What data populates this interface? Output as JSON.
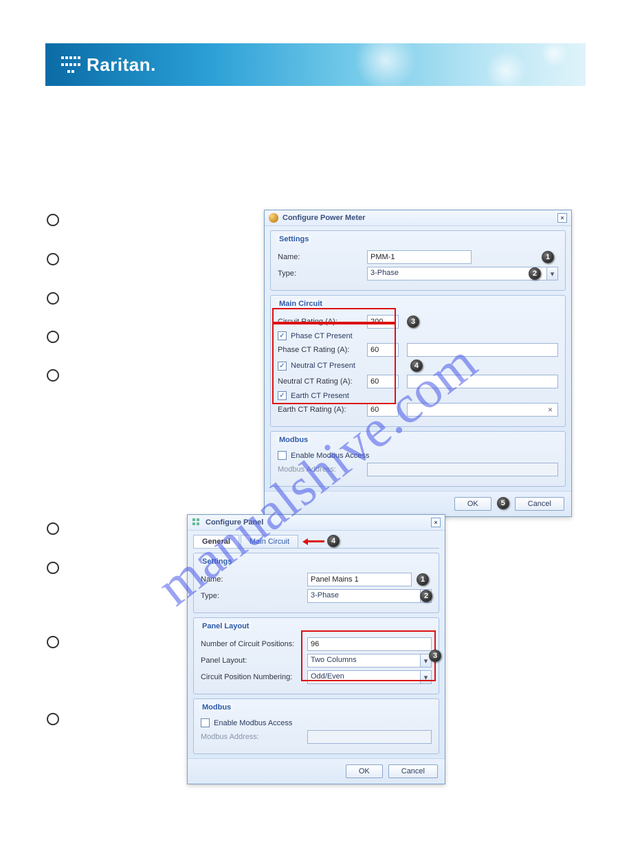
{
  "logo_text": "Raritan",
  "logo_dot": ".",
  "dialog1": {
    "title": "Configure Power Meter",
    "settings_title": "Settings",
    "name_label": "Name:",
    "name_value": "PMM-1",
    "type_label": "Type:",
    "type_value": "3-Phase",
    "main_circuit_title": "Main Circuit",
    "circuit_rating_label": "Circuit Rating (A):",
    "circuit_rating_value": "200",
    "phase_ct_present": "Phase CT Present",
    "phase_ct_rating_label": "Phase CT Rating (A):",
    "phase_ct_rating_value": "60",
    "neutral_ct_present": "Neutral CT Present",
    "neutral_ct_rating_label": "Neutral CT Rating (A):",
    "neutral_ct_rating_value": "60",
    "earth_ct_present": "Earth CT Present",
    "earth_ct_rating_label": "Earth CT Rating (A):",
    "earth_ct_rating_value": "60",
    "modbus_title": "Modbus",
    "enable_modbus": "Enable Modbus Access",
    "modbus_addr_label": "Modbus Address:",
    "ok": "OK",
    "cancel": "Cancel",
    "close_x": "×",
    "clear_x": "×",
    "check": "✓",
    "caret": "▾",
    "b1": "1",
    "b2": "2",
    "b3": "3",
    "b4": "4",
    "b5": "5"
  },
  "dialog2": {
    "title": "Configure Panel",
    "tab_general": "General",
    "tab_main": "Main Circuit",
    "settings_title": "Settings",
    "name_label": "Name:",
    "name_value": "Panel Mains 1",
    "type_label": "Type:",
    "type_value": "3-Phase",
    "panel_layout_title": "Panel Layout",
    "num_positions_label": "Number of Circuit Positions:",
    "num_positions_value": "96",
    "panel_layout_label": "Panel Layout:",
    "panel_layout_value": "Two Columns",
    "numbering_label": "Circuit Position Numbering:",
    "numbering_value": "Odd/Even",
    "modbus_title": "Modbus",
    "enable_modbus": "Enable Modbus Access",
    "modbus_addr_label": "Modbus Address:",
    "ok": "OK",
    "cancel": "Cancel",
    "close_x": "×",
    "caret": "▾",
    "b1": "1",
    "b2": "2",
    "b3": "3",
    "b4": "4"
  },
  "watermark": "manualshive.com"
}
